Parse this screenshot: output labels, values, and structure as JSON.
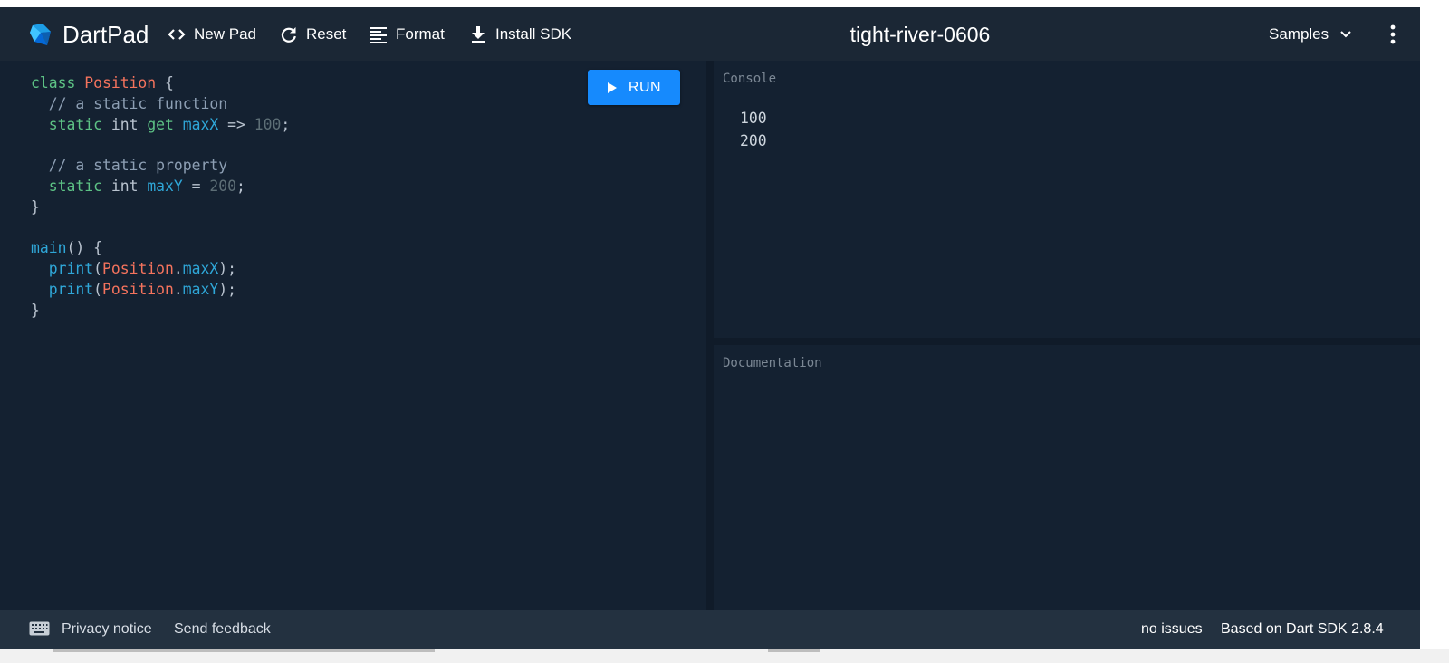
{
  "header": {
    "brand": "DartPad",
    "toolbar": {
      "new_pad": "New Pad",
      "reset": "Reset",
      "format": "Format",
      "install_sdk": "Install SDK"
    },
    "pad_title": "tight-river-0606",
    "samples_label": "Samples"
  },
  "editor": {
    "run_label": "RUN",
    "code": {
      "l1_kw": "class",
      "l1_cls": "Position",
      "l1_rest": " {",
      "l2_cm": "// a static function",
      "l3_kw": "static",
      "l3_mid": " int ",
      "l3_kw2": "get",
      "l3_fn": "maxX",
      "l3_op": " => ",
      "l3_num": "100",
      "l3_end": ";",
      "l5_cm": "// a static property",
      "l6_kw": "static",
      "l6_mid": " int ",
      "l6_fn": "maxY",
      "l6_op": " = ",
      "l6_num": "200",
      "l6_end": ";",
      "l7": "}",
      "l9_fn": "main",
      "l9_rest": "() {",
      "l10_fn": "print",
      "l10_p": "(",
      "l10_cls": "Position",
      "l10_dot": ".",
      "l10_fn2": "maxX",
      "l10_end": ");",
      "l11_fn": "print",
      "l11_p": "(",
      "l11_cls": "Position",
      "l11_dot": ".",
      "l11_fn2": "maxY",
      "l11_end": ");",
      "l12": "}"
    }
  },
  "console": {
    "label": "Console",
    "output": [
      "100",
      "200"
    ]
  },
  "documentation": {
    "label": "Documentation"
  },
  "footer": {
    "privacy": "Privacy notice",
    "feedback": "Send feedback",
    "issues": "no issues",
    "sdk": "Based on Dart SDK 2.8.4"
  },
  "colors": {
    "background": "#142131",
    "header": "#1b2735",
    "footer": "#233140",
    "run_button": "#168afd",
    "keyword": "#5dc285",
    "class_name": "#f5735d",
    "identifier": "#2fa7d8",
    "comment": "#8d9fb4",
    "number": "#5d6e76"
  },
  "icons": [
    "dart-logo-icon",
    "code-icon",
    "refresh-icon",
    "format-align-icon",
    "download-icon",
    "chevron-down-icon",
    "more-vert-icon",
    "play-icon",
    "keyboard-icon"
  ]
}
